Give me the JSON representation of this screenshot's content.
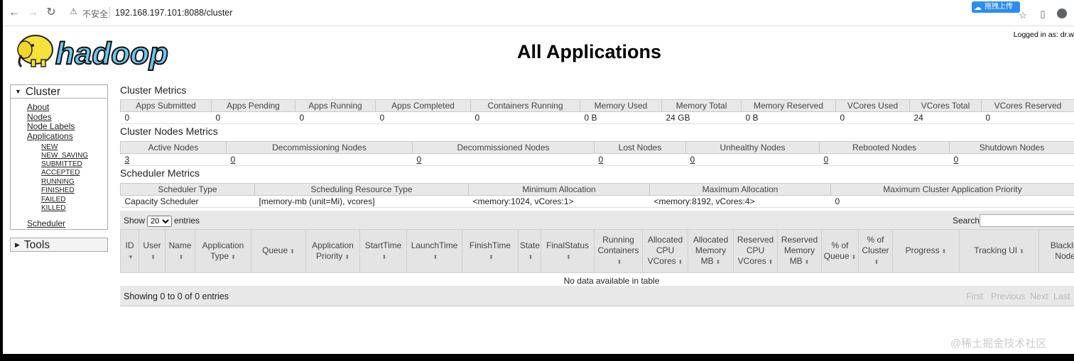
{
  "browser": {
    "insecure_label": "不安全",
    "url": "192.168.197.101:8088/cluster",
    "upload_badge": "拖拽上传"
  },
  "header": {
    "logo_text": "hadoop",
    "logged_in": "Logged in as: dr.w",
    "title": "All Applications"
  },
  "nav": {
    "cluster_label": "Cluster",
    "links": [
      "About",
      "Nodes",
      "Node Labels",
      "Applications"
    ],
    "states": [
      "NEW",
      "NEW_SAVING",
      "SUBMITTED",
      "ACCEPTED",
      "RUNNING",
      "FINISHED",
      "FAILED",
      "KILLED"
    ],
    "scheduler": "Scheduler",
    "tools_label": "Tools"
  },
  "cluster_metrics": {
    "title": "Cluster Metrics",
    "headers": [
      "Apps Submitted",
      "Apps Pending",
      "Apps Running",
      "Apps Completed",
      "Containers Running",
      "Memory Used",
      "Memory Total",
      "Memory Reserved",
      "VCores Used",
      "VCores Total",
      "VCores Reserved"
    ],
    "values": [
      "0",
      "0",
      "0",
      "0",
      "0",
      "0 B",
      "24 GB",
      "0 B",
      "0",
      "24",
      "0"
    ]
  },
  "nodes_metrics": {
    "title": "Cluster Nodes Metrics",
    "headers": [
      "Active Nodes",
      "Decommissioning Nodes",
      "Decommissioned Nodes",
      "Lost Nodes",
      "Unhealthy Nodes",
      "Rebooted Nodes",
      "Shutdown Nodes"
    ],
    "values": [
      "3",
      "0",
      "0",
      "0",
      "0",
      "0",
      "0"
    ]
  },
  "scheduler_metrics": {
    "title": "Scheduler Metrics",
    "headers": [
      "Scheduler Type",
      "Scheduling Resource Type",
      "Minimum Allocation",
      "Maximum Allocation",
      "Maximum Cluster Application Priority"
    ],
    "values": [
      "Capacity Scheduler",
      "[memory-mb (unit=Mi), vcores]",
      "<memory:1024, vCores:1>",
      "<memory:8192, vCores:4>",
      "0"
    ]
  },
  "apps_table": {
    "show_label": "Show",
    "page_size": "20",
    "entries_label": "entries",
    "search_label": "Search:",
    "headers": [
      "ID",
      "User",
      "Name",
      "Application Type",
      "Queue",
      "Application Priority",
      "StartTime",
      "LaunchTime",
      "FinishTime",
      "State",
      "FinalStatus",
      "Running Containers",
      "Allocated CPU VCores",
      "Allocated Memory MB",
      "Reserved CPU VCores",
      "Reserved Memory MB",
      "% of Queue",
      "% of Cluster",
      "Progress",
      "Tracking UI",
      "Blacklisted Nodes"
    ],
    "no_data": "No data available in table",
    "showing": "Showing 0 to 0 of 0 entries",
    "pager": [
      "First",
      "Previous",
      "Next",
      "Last"
    ]
  },
  "watermark": "@稀土掘金技术社区"
}
